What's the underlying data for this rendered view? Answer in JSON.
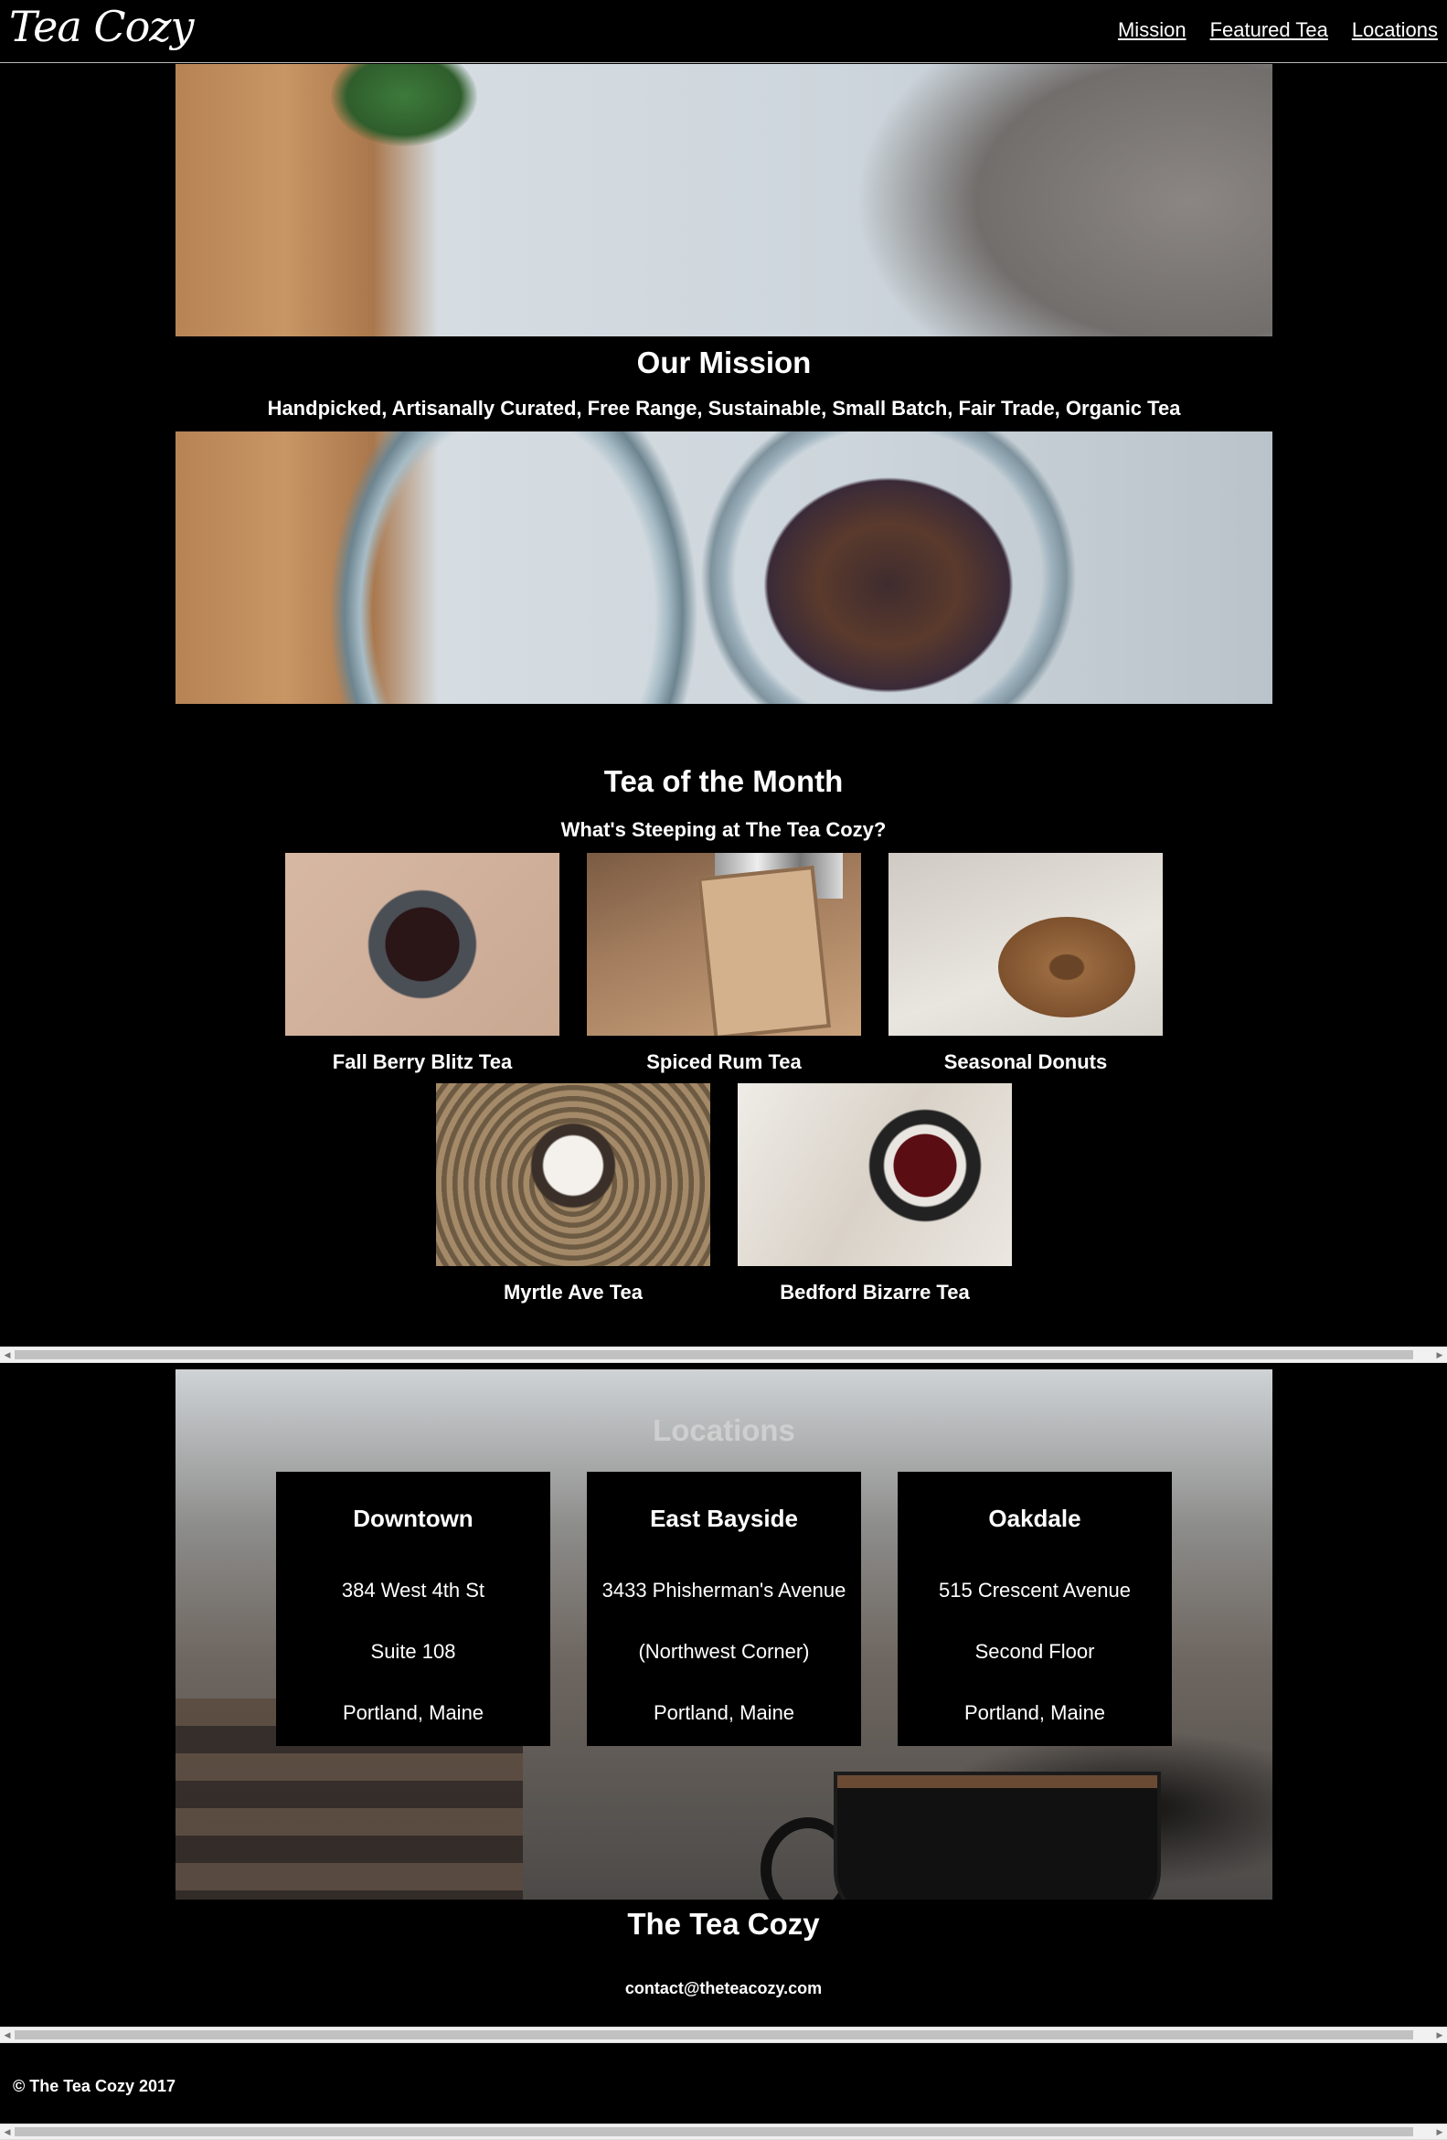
{
  "header": {
    "logo": "Tea Cozy",
    "nav": [
      "Mission",
      "Featured Tea",
      "Locations"
    ]
  },
  "mission": {
    "title": "Our Mission",
    "subtitle": "Handpicked, Artisanally Curated, Free Range, Sustainable, Small Batch, Fair Trade, Organic Tea"
  },
  "tea": {
    "title": "Tea of the Month",
    "subtitle": "What's Steeping at The Tea Cozy?",
    "items": [
      "Fall Berry Blitz Tea",
      "Spiced Rum Tea",
      "Seasonal Donuts",
      "Myrtle Ave Tea",
      "Bedford Bizarre Tea"
    ]
  },
  "locations": {
    "title": "Locations",
    "cards": [
      {
        "name": "Downtown",
        "lines": [
          "384 West 4th St",
          "Suite 108",
          "Portland, Maine"
        ]
      },
      {
        "name": "East Bayside",
        "lines": [
          "3433 Phisherman's Avenue",
          "(Northwest Corner)",
          "Portland, Maine"
        ]
      },
      {
        "name": "Oakdale",
        "lines": [
          "515 Crescent Avenue",
          "Second Floor",
          "Portland, Maine"
        ]
      }
    ]
  },
  "contact": {
    "brand": "The Tea Cozy",
    "email": "contact@theteacozy.com"
  },
  "footer": {
    "copyright": "© The Tea Cozy 2017"
  }
}
